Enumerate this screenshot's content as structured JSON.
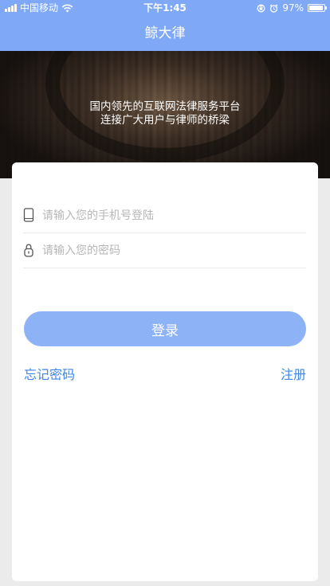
{
  "status_bar": {
    "carrier": "中国移动",
    "time": "下午1:45",
    "battery_text": "97%",
    "battery_level": 0.97
  },
  "nav": {
    "title": "鲸大律"
  },
  "hero": {
    "line1": "国内领先的互联网法律服务平台",
    "line2": "连接广大用户与律师的桥梁"
  },
  "form": {
    "phone_placeholder": "请输入您的手机号登陆",
    "password_placeholder": "请输入您的密码",
    "login_label": "登录",
    "forgot_label": "忘记密码",
    "register_label": "注册"
  },
  "colors": {
    "accent": "#7fa9f6",
    "button": "#8db3f6",
    "link": "#3d86ec"
  },
  "icons": [
    "signal-icon",
    "wifi-icon",
    "rotation-lock-icon",
    "alarm-icon",
    "battery-icon",
    "phone-icon",
    "lock-icon"
  ]
}
